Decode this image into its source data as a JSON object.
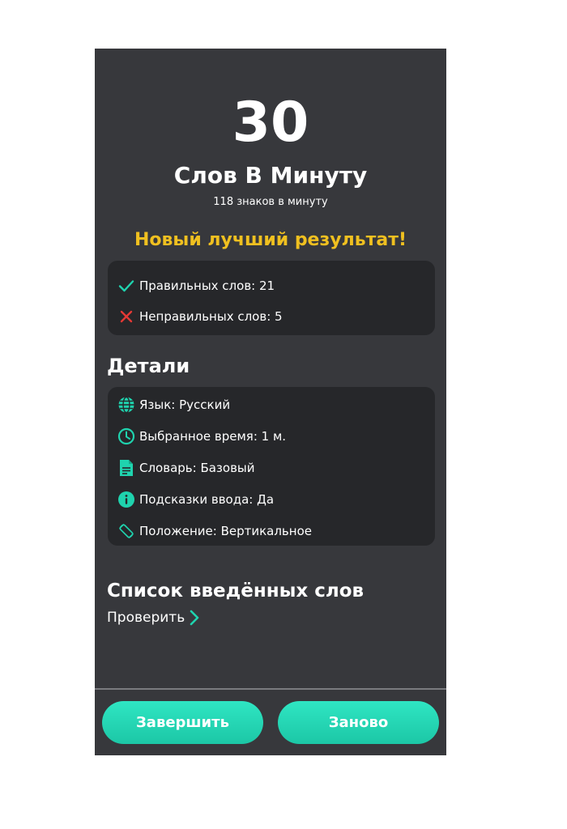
{
  "result": {
    "wpm_value": "30",
    "wpm_label": "Слов В Минуту",
    "cpm_text": "118 знаков в минуту",
    "best_text": "Новый лучший результат!"
  },
  "stats": {
    "correct": {
      "icon": "check-icon",
      "text": "Правильных слов: 21"
    },
    "incorrect": {
      "icon": "cross-icon",
      "text": "Неправильных слов: 5"
    }
  },
  "details": {
    "title": "Детали",
    "items": [
      {
        "icon": "globe-icon",
        "text": "Язык: Русский"
      },
      {
        "icon": "clock-icon",
        "text": "Выбранное время: 1 м."
      },
      {
        "icon": "document-icon",
        "text": "Словарь: Базовый"
      },
      {
        "icon": "info-icon",
        "text": "Подсказки ввода: Да"
      },
      {
        "icon": "rotate-icon",
        "text": "Положение: Вертикальное"
      }
    ]
  },
  "words_list": {
    "title": "Список введённых слов",
    "check_label": "Проверить"
  },
  "buttons": {
    "finish_label": "Завершить",
    "restart_label": "Заново"
  },
  "colors": {
    "background": "#37383c",
    "card": "#26272a",
    "accent": "#1fd3ae",
    "highlight": "#f0c020",
    "error": "#e53935"
  }
}
